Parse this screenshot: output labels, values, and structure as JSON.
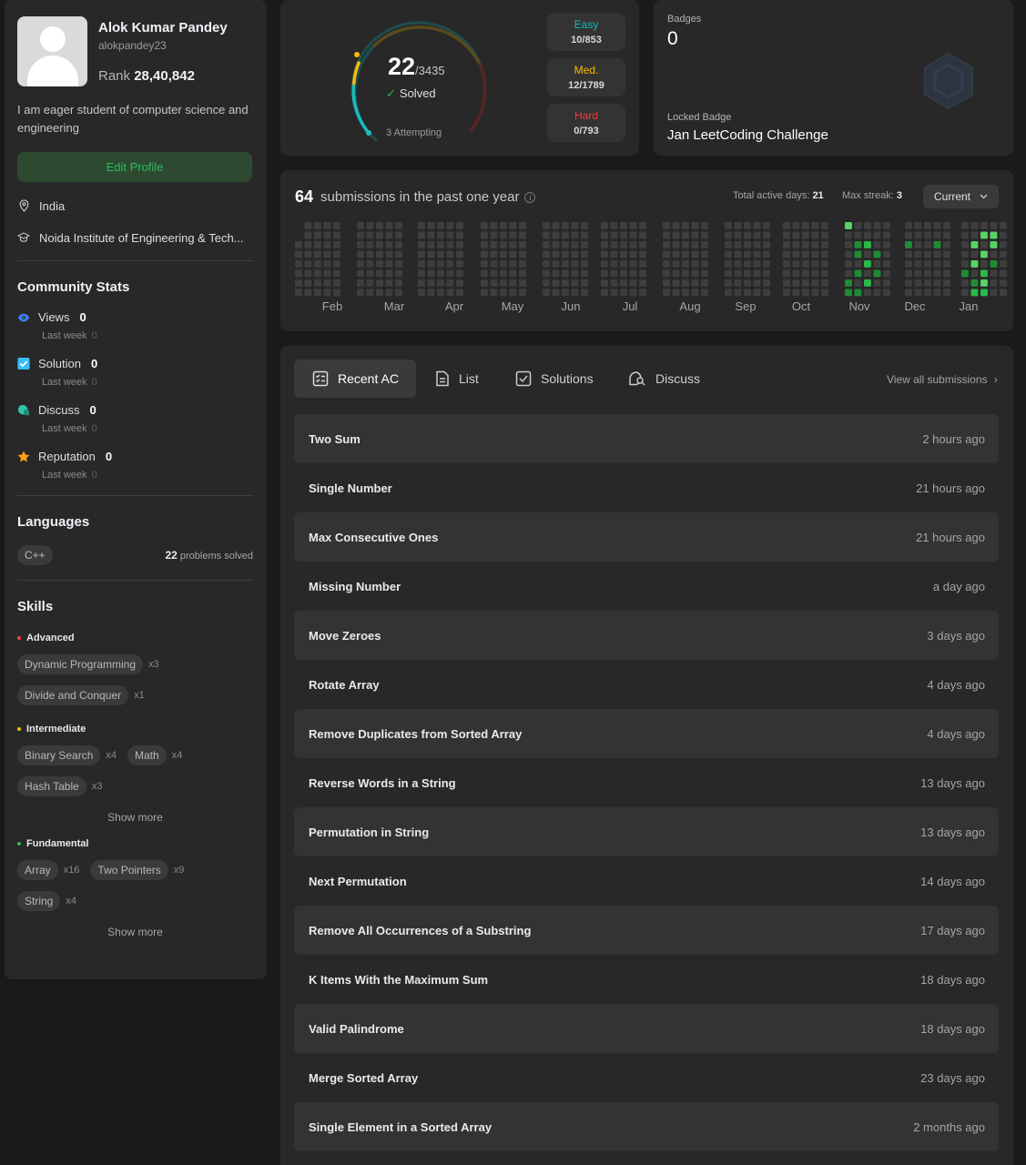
{
  "profile": {
    "name": "Alok Kumar Pandey",
    "username": "alokpandey23",
    "rank_label": "Rank",
    "rank_value": "28,40,842",
    "bio": "I am eager student of computer science and engineering",
    "edit_label": "Edit Profile",
    "country": "India",
    "school": "Noida Institute of Engineering & Tech..."
  },
  "community": {
    "title": "Community Stats",
    "items": [
      {
        "label": "Views",
        "value": "0",
        "sub": "Last week",
        "sub_value": "0",
        "icon": "eye-icon",
        "color": "#3b82f6"
      },
      {
        "label": "Solution",
        "value": "0",
        "sub": "Last week",
        "sub_value": "0",
        "icon": "check-square-icon",
        "color": "#38bdf8"
      },
      {
        "label": "Discuss",
        "value": "0",
        "sub": "Last week",
        "sub_value": "0",
        "icon": "chat-icon",
        "color": "#2ec4a5"
      },
      {
        "label": "Reputation",
        "value": "0",
        "sub": "Last week",
        "sub_value": "0",
        "icon": "star-icon",
        "color": "#ffa116"
      }
    ]
  },
  "languages": {
    "title": "Languages",
    "items": [
      {
        "name": "C++",
        "count": "22",
        "suffix": "problems solved"
      }
    ]
  },
  "skills": {
    "title": "Skills",
    "advanced": {
      "label": "Advanced",
      "color": "#ef4743",
      "tags": [
        {
          "name": "Dynamic Programming",
          "mult": "x3"
        },
        {
          "name": "Divide and Conquer",
          "mult": "x1"
        }
      ]
    },
    "intermediate": {
      "label": "Intermediate",
      "color": "#ffb800",
      "tags": [
        {
          "name": "Binary Search",
          "mult": "x4"
        },
        {
          "name": "Math",
          "mult": "x4"
        },
        {
          "name": "Hash Table",
          "mult": "x3"
        }
      ]
    },
    "fundamental": {
      "label": "Fundamental",
      "color": "#2cbb5d",
      "tags": [
        {
          "name": "Array",
          "mult": "x16"
        },
        {
          "name": "Two Pointers",
          "mult": "x9"
        },
        {
          "name": "String",
          "mult": "x4"
        }
      ]
    },
    "show_more": "Show more"
  },
  "solved": {
    "count": "22",
    "total": "/3435",
    "label": "Solved",
    "attempting": "3 Attempting",
    "easy": {
      "label": "Easy",
      "value": "10/853",
      "color": "#1cbaba"
    },
    "medium": {
      "label": "Med.",
      "value": "12/1789",
      "color": "#ffb800"
    },
    "hard": {
      "label": "Hard",
      "value": "0/793",
      "color": "#f63737"
    }
  },
  "badges": {
    "title": "Badges",
    "count": "0",
    "locked_label": "Locked Badge",
    "locked_name": "Jan LeetCoding Challenge"
  },
  "heatmap": {
    "count": "64",
    "text": "submissions in the past one year",
    "active_label": "Total active days:",
    "active_value": "21",
    "streak_label": "Max streak:",
    "streak_value": "3",
    "select": "Current",
    "months": [
      "Feb",
      "Mar",
      "Apr",
      "May",
      "Jun",
      "Jul",
      "Aug",
      "Sep",
      "Oct",
      "Nov",
      "Dec",
      "Jan"
    ]
  },
  "recent": {
    "tabs": [
      "Recent AC",
      "List",
      "Solutions",
      "Discuss"
    ],
    "view_all": "View all submissions",
    "items": [
      {
        "title": "Two Sum",
        "when": "2 hours ago"
      },
      {
        "title": "Single Number",
        "when": "21 hours ago"
      },
      {
        "title": "Max Consecutive Ones",
        "when": "21 hours ago"
      },
      {
        "title": "Missing Number",
        "when": "a day ago"
      },
      {
        "title": "Move Zeroes",
        "when": "3 days ago"
      },
      {
        "title": "Rotate Array",
        "when": "4 days ago"
      },
      {
        "title": "Remove Duplicates from Sorted Array",
        "when": "4 days ago"
      },
      {
        "title": "Reverse Words in a String",
        "when": "13 days ago"
      },
      {
        "title": "Permutation in String",
        "when": "13 days ago"
      },
      {
        "title": "Next Permutation",
        "when": "14 days ago"
      },
      {
        "title": "Remove All Occurrences of a Substring",
        "when": "17 days ago"
      },
      {
        "title": "K Items With the Maximum Sum",
        "when": "18 days ago"
      },
      {
        "title": "Valid Palindrome",
        "when": "18 days ago"
      },
      {
        "title": "Merge Sorted Array",
        "when": "23 days ago"
      },
      {
        "title": "Single Element in a Sorted Array",
        "when": "2 months ago"
      }
    ]
  }
}
